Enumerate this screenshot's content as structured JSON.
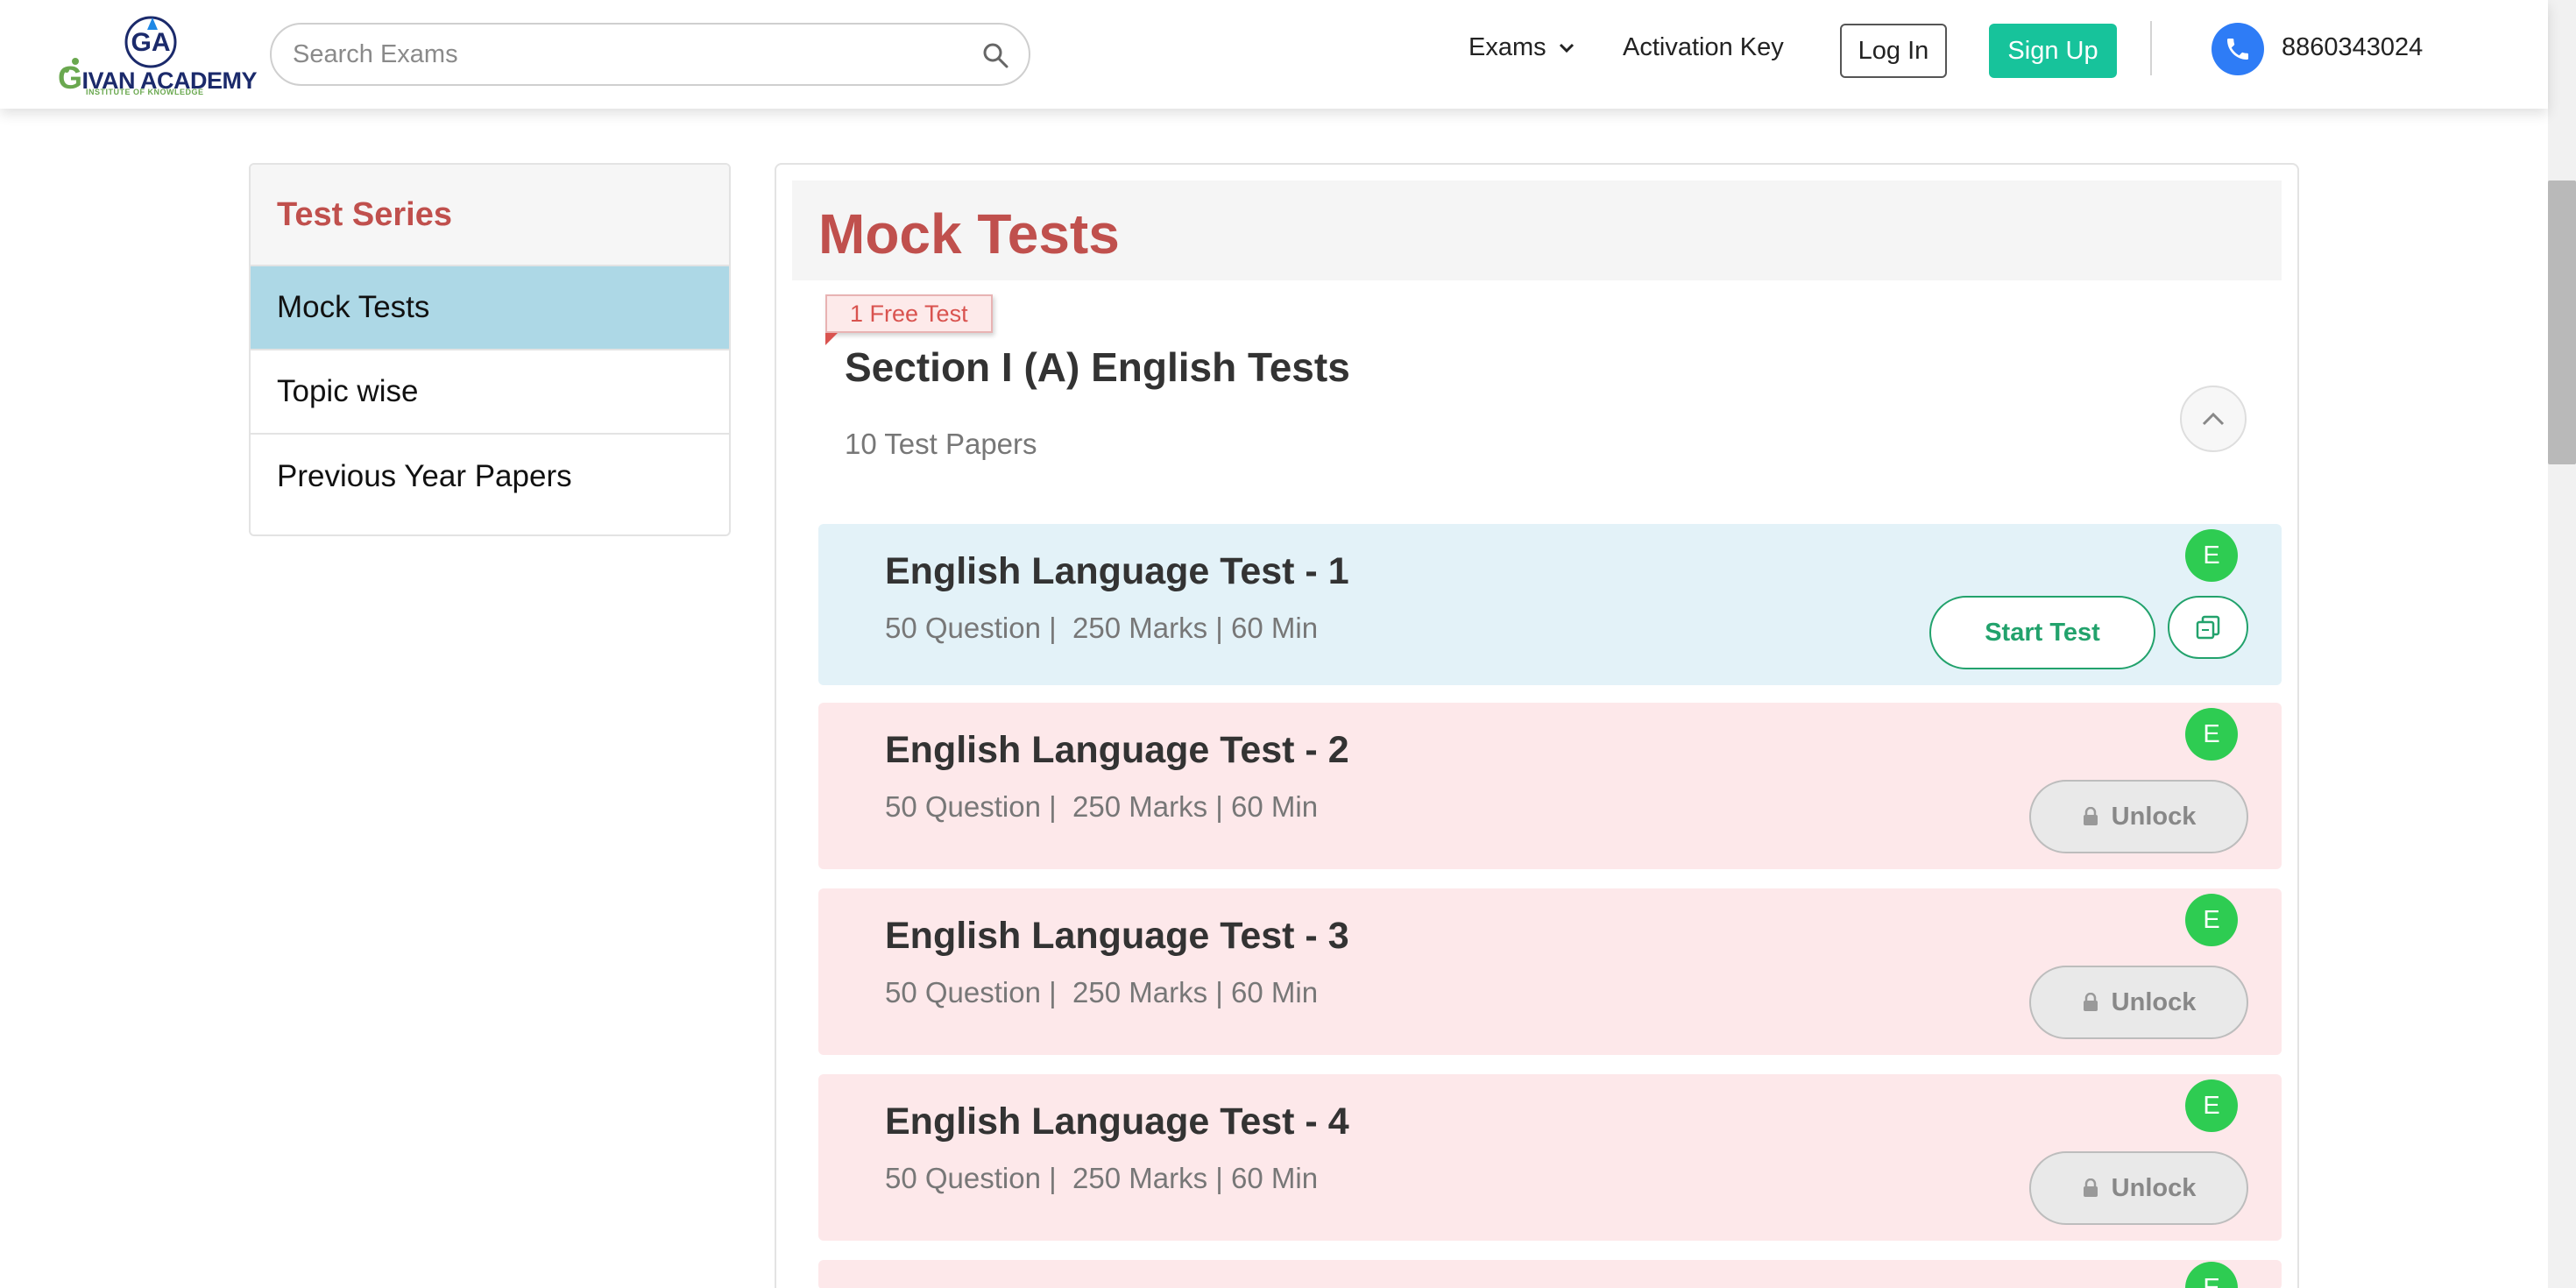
{
  "header": {
    "logo_text": "IVAN ACADEMY",
    "logo_initial": "G",
    "logo_tagline": "INSTITUTE OF KNOWLEDGE",
    "search_placeholder": "Search Exams",
    "nav_exams": "Exams",
    "nav_activation": "Activation Key",
    "login_label": "Log In",
    "signup_label": "Sign Up",
    "phone": "8860343024"
  },
  "sidebar": {
    "title": "Test Series",
    "items": [
      {
        "label": "Mock Tests",
        "active": true
      },
      {
        "label": "Topic wise",
        "active": false
      },
      {
        "label": "Previous Year Papers",
        "active": false
      }
    ]
  },
  "main": {
    "title": "Mock Tests",
    "ribbon": "1 Free Test",
    "section_title": "Section I (A) English Tests",
    "section_count": "10 Test Papers",
    "tests": [
      {
        "name": "English Language Test - 1",
        "meta": "50 Question |  250 Marks | 60 Min",
        "badge": "E",
        "status": "free",
        "action": "Start Test"
      },
      {
        "name": "English Language Test - 2",
        "meta": "50 Question |  250 Marks | 60 Min",
        "badge": "E",
        "status": "locked",
        "action": "Unlock"
      },
      {
        "name": "English Language Test - 3",
        "meta": "50 Question |  250 Marks | 60 Min",
        "badge": "E",
        "status": "locked",
        "action": "Unlock"
      },
      {
        "name": "English Language Test - 4",
        "meta": "50 Question |  250 Marks | 60 Min",
        "badge": "E",
        "status": "locked",
        "action": "Unlock"
      },
      {
        "name": "",
        "meta": "",
        "badge": "E",
        "status": "locked",
        "action": ""
      }
    ]
  },
  "colors": {
    "accent_red": "#c0504d",
    "signup_green": "#17c39b",
    "start_green": "#22a26c",
    "badge_green": "#2ecc52",
    "active_blue": "#add8e6",
    "free_card": "#e3f2f8",
    "locked_card": "#fde8ea",
    "phone_blue": "#2e7cf6"
  }
}
